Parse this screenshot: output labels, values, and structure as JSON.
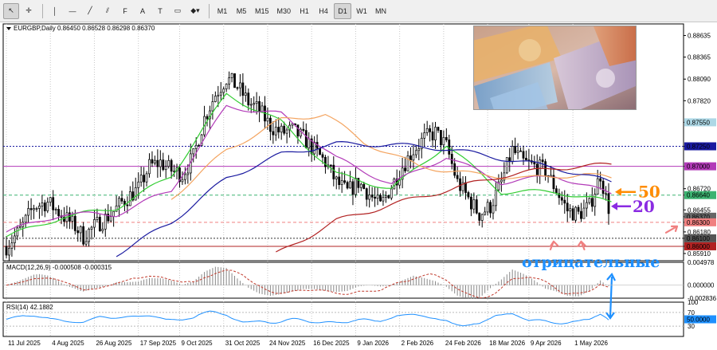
{
  "toolbar": {
    "tools": [
      {
        "name": "cursor-icon",
        "glyph": "↖"
      },
      {
        "name": "crosshair-icon",
        "glyph": "✛"
      },
      {
        "name": "vertical-line-icon",
        "glyph": "│"
      },
      {
        "name": "horizontal-line-icon",
        "glyph": "—"
      },
      {
        "name": "trendline-icon",
        "glyph": "╱"
      },
      {
        "name": "channel-icon",
        "glyph": "⫽"
      },
      {
        "name": "fibonacci-icon",
        "glyph": "F"
      },
      {
        "name": "text-icon",
        "glyph": "A"
      },
      {
        "name": "text-label-icon",
        "glyph": "T"
      },
      {
        "name": "rectangle-icon",
        "glyph": "▭"
      },
      {
        "name": "shapes-menu-icon",
        "glyph": "◆▾"
      }
    ],
    "timeframes": [
      "M1",
      "M5",
      "M15",
      "M30",
      "H1",
      "H4",
      "D1",
      "W1",
      "MN"
    ],
    "active_timeframe": "D1"
  },
  "colors": {
    "bull": "#000000",
    "ma_fast": "#32cd32",
    "ma_mid": "#b23ab8",
    "ma_slow": "#f4a460",
    "ma_long_blue": "#1a1aa0",
    "ma_long_red": "#b22222",
    "annotation_orange": "#ff8c00",
    "annotation_purple": "#8a2be2",
    "annotation_blue": "#1e90ff",
    "annotation_pink": "#f08080"
  },
  "chart_data": [
    {
      "type": "candlestick",
      "title": "EURGBP,Daily  0.86450 0.86528 0.86298 0.86370",
      "symbol": "EURGBP",
      "timeframe": "Daily",
      "ohlc_last": {
        "open": 0.8645,
        "high": 0.86528,
        "low": 0.86298,
        "close": 0.8637
      },
      "ylim": [
        0.8582,
        0.8878
      ],
      "y_ticks": [
        0.88635,
        0.88365,
        0.8809,
        0.8782,
        0.8755,
        0.8725,
        0.87,
        0.8672,
        0.8664,
        0.86455,
        0.8637,
        0.863,
        0.8618,
        0.861,
        0.86,
        0.8591
      ],
      "x_ticks": [
        "11 Jul 2025",
        "4 Aug 2025",
        "26 Aug 2025",
        "17 Sep 2025",
        "9 Oct 2025",
        "31 Oct 2025",
        "24 Nov 2025",
        "16 Dec 2025",
        "9 Jan 2026",
        "2 Feb 2026",
        "24 Feb 2026",
        "18 Mar 2026",
        "9 Apr 2026",
        "1 May 2026"
      ],
      "candle_count": 220,
      "close_path": [
        [
          0,
          0.86
        ],
        [
          5,
          0.862
        ],
        [
          10,
          0.865
        ],
        [
          15,
          0.8655
        ],
        [
          20,
          0.864
        ],
        [
          25,
          0.8625
        ],
        [
          28,
          0.8612
        ],
        [
          32,
          0.8625
        ],
        [
          38,
          0.864
        ],
        [
          42,
          0.8655
        ],
        [
          48,
          0.8672
        ],
        [
          52,
          0.87
        ],
        [
          56,
          0.8705
        ],
        [
          60,
          0.8695
        ],
        [
          64,
          0.869
        ],
        [
          68,
          0.8712
        ],
        [
          72,
          0.876
        ],
        [
          76,
          0.879
        ],
        [
          80,
          0.881
        ],
        [
          84,
          0.88
        ],
        [
          88,
          0.878
        ],
        [
          92,
          0.877
        ],
        [
          96,
          0.875
        ],
        [
          100,
          0.8742
        ],
        [
          104,
          0.8745
        ],
        [
          108,
          0.8735
        ],
        [
          112,
          0.872
        ],
        [
          116,
          0.8705
        ],
        [
          120,
          0.868
        ],
        [
          124,
          0.8668
        ],
        [
          128,
          0.868
        ],
        [
          132,
          0.8665
        ],
        [
          136,
          0.865
        ],
        [
          140,
          0.8675
        ],
        [
          144,
          0.87
        ],
        [
          148,
          0.872
        ],
        [
          152,
          0.8735
        ],
        [
          156,
          0.8742
        ],
        [
          160,
          0.8725
        ],
        [
          164,
          0.868
        ],
        [
          168,
          0.866
        ],
        [
          172,
          0.864
        ],
        [
          176,
          0.865
        ],
        [
          180,
          0.868
        ],
        [
          184,
          0.872
        ],
        [
          188,
          0.8705
        ],
        [
          192,
          0.87
        ],
        [
          196,
          0.8695
        ],
        [
          200,
          0.867
        ],
        [
          204,
          0.8645
        ],
        [
          208,
          0.864
        ],
        [
          212,
          0.865
        ],
        [
          216,
          0.869
        ],
        [
          218,
          0.866
        ],
        [
          220,
          0.8637
        ]
      ],
      "moving_averages": [
        {
          "period": "fast",
          "color_key": "ma_fast",
          "points": [
            [
              0,
              0.8612
            ],
            [
              20,
              0.8636
            ],
            [
              40,
              0.8648
            ],
            [
              60,
              0.8688
            ],
            [
              80,
              0.879
            ],
            [
              100,
              0.8755
            ],
            [
              120,
              0.869
            ],
            [
              140,
              0.8672
            ],
            [
              160,
              0.8727
            ],
            [
              180,
              0.8668
            ],
            [
              200,
              0.8668
            ],
            [
              220,
              0.8655
            ]
          ]
        },
        {
          "period": "mid",
          "color_key": "ma_mid",
          "points": [
            [
              0,
              0.8618
            ],
            [
              20,
              0.864
            ],
            [
              40,
              0.864
            ],
            [
              60,
              0.867
            ],
            [
              80,
              0.8775
            ],
            [
              100,
              0.8765
            ],
            [
              120,
              0.871
            ],
            [
              140,
              0.8678
            ],
            [
              160,
              0.8712
            ],
            [
              180,
              0.868
            ],
            [
              200,
              0.8688
            ],
            [
              220,
              0.8665
            ]
          ]
        },
        {
          "period": "slow",
          "color_key": "ma_slow",
          "points": [
            [
              60,
              0.866
            ],
            [
              80,
              0.872
            ],
            [
              100,
              0.8758
            ],
            [
              116,
              0.8765
            ],
            [
              130,
              0.873
            ],
            [
              150,
              0.87
            ],
            [
              170,
              0.869
            ],
            [
              190,
              0.8685
            ],
            [
              210,
              0.869
            ],
            [
              220,
              0.8685
            ]
          ]
        },
        {
          "period": "long-blue",
          "color_key": "ma_long_blue",
          "points": [
            [
              40,
              0.859
            ],
            [
              60,
              0.863
            ],
            [
              80,
              0.8685
            ],
            [
              100,
              0.8715
            ],
            [
              120,
              0.8728
            ],
            [
              140,
              0.8727
            ],
            [
              160,
              0.8722
            ],
            [
              180,
              0.871
            ],
            [
              200,
              0.8698
            ],
            [
              220,
              0.868
            ]
          ]
        },
        {
          "period": "long-red",
          "color_key": "ma_long_red",
          "points": [
            [
              98,
              0.859
            ],
            [
              120,
              0.8632
            ],
            [
              140,
              0.8652
            ],
            [
              160,
              0.867
            ],
            [
              180,
              0.8688
            ],
            [
              200,
              0.8698
            ],
            [
              220,
              0.8702
            ]
          ]
        }
      ],
      "horizontal_levels": [
        {
          "value": 0.8725,
          "color": "#1a1aa0",
          "style": "dotted"
        },
        {
          "value": 0.87,
          "color": "#b23ab8",
          "style": "solid"
        },
        {
          "value": 0.8664,
          "color": "#3cb371",
          "style": "dashed"
        },
        {
          "value": 0.863,
          "color": "#f08080",
          "style": "dashed"
        },
        {
          "value": 0.861,
          "color": "#333333",
          "style": "dotted"
        },
        {
          "value": 0.86,
          "color": "#b22222",
          "style": "solid"
        }
      ],
      "price_tags": [
        {
          "value": 0.8755,
          "label": "0.87550",
          "color": "#add8e6"
        },
        {
          "value": 0.8725,
          "label": "0.87250",
          "color": "#1a1aa0"
        },
        {
          "value": 0.87,
          "label": "0.87000",
          "color": "#b23ab8"
        },
        {
          "value": 0.8664,
          "label": "0.86640",
          "color": "#3cb371"
        },
        {
          "value": 0.8637,
          "label": "0.86370",
          "color": "#666666"
        },
        {
          "value": 0.863,
          "label": "0.86300",
          "color": "#f08080"
        },
        {
          "value": 0.861,
          "label": "0.86100",
          "color": "#555555"
        },
        {
          "value": 0.86,
          "label": "0.86000",
          "color": "#b22222"
        }
      ],
      "annotations": [
        {
          "text": "50",
          "color_key": "annotation_orange",
          "value": 0.8668
        },
        {
          "text": "20",
          "color_key": "annotation_purple",
          "value": 0.865
        },
        {
          "text": "отрицательные",
          "color_key": "annotation_blue"
        }
      ]
    },
    {
      "type": "histogram",
      "title": "MACD(12,26,9) -0.000508 -0.000315",
      "indicator": "MACD",
      "params": [
        12,
        26,
        9
      ],
      "values_last": {
        "main": -0.000508,
        "signal": -0.000315
      },
      "ylim": [
        -0.00283,
        0.00497
      ],
      "y_ticks": [
        {
          "value": 0.004978,
          "label": "0.004978"
        },
        {
          "value": 0.0,
          "label": "0.000000"
        },
        {
          "value": -0.002836,
          "label": "-0.002836"
        }
      ]
    },
    {
      "type": "line",
      "title": "RSI(14) 42.1882",
      "indicator": "RSI",
      "period": 14,
      "value_last": 42.1882,
      "ylim": [
        0,
        100
      ],
      "y_ticks": [
        {
          "value": 100,
          "label": "100"
        },
        {
          "value": 70,
          "label": "70"
        },
        {
          "value": 50,
          "label": "50.0000"
        },
        {
          "value": 30,
          "label": "30"
        }
      ]
    }
  ]
}
